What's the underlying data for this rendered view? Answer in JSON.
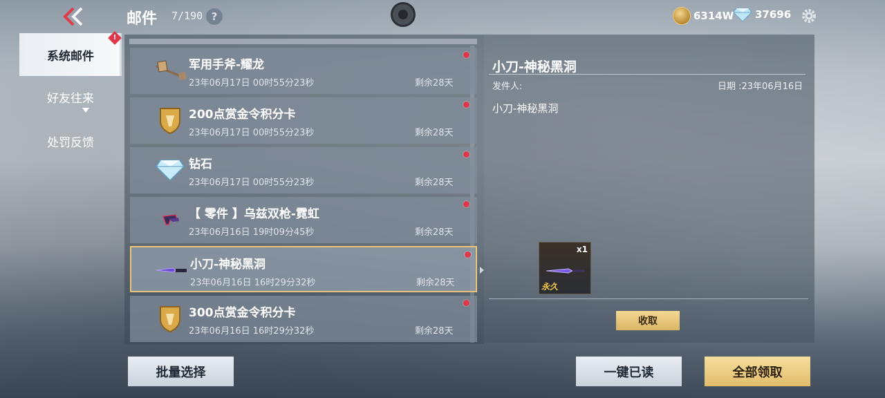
{
  "header": {
    "title": "邮件",
    "count": "7/190",
    "help_symbol": "?",
    "coins": "6314W",
    "diamonds": "37696"
  },
  "sidebar": {
    "items": [
      {
        "label": "系统邮件",
        "active": true,
        "badge": "!"
      },
      {
        "label": "好友往来",
        "active": false
      },
      {
        "label": "处罚反馈",
        "active": false
      }
    ]
  },
  "mails": [
    {
      "title": "军用手斧-耀龙",
      "date": "23年06月17日 00时55分23秒",
      "remain": "剩余28天",
      "icon": "axe-icon",
      "selected": false
    },
    {
      "title": "200点赏金令积分卡",
      "date": "23年06月17日 00时55分23秒",
      "remain": "剩余28天",
      "icon": "gold-shield-icon",
      "selected": false
    },
    {
      "title": "钻石",
      "date": "23年06月17日 00时55分23秒",
      "remain": "剩余28天",
      "icon": "diamond-icon",
      "selected": false
    },
    {
      "title": "【 零件 】乌兹双枪-霓虹",
      "date": "23年06月16日 19时09分45秒",
      "remain": "剩余28天",
      "icon": "dual-uzi-part-icon",
      "selected": false
    },
    {
      "title": "小刀-神秘黑洞",
      "date": "23年06月16日 16时29分32秒",
      "remain": "剩余28天",
      "icon": "knife-icon",
      "selected": true
    },
    {
      "title": "300点赏金令积分卡",
      "date": "23年06月16日 16时29分32秒",
      "remain": "剩余28天",
      "icon": "gold-shield-icon",
      "selected": false
    }
  ],
  "detail": {
    "title": "小刀-神秘黑洞",
    "sender_label": "发件人:",
    "date_label": "日期 :23年06月16日",
    "body": "小刀-神秘黑洞",
    "attachment": {
      "qty": "x1",
      "tag": "永久",
      "icon": "knife-icon"
    },
    "claim_label": "收取"
  },
  "actions": {
    "batch_select": "批量选择",
    "mark_all_read": "一键已读",
    "claim_all": "全部领取"
  },
  "colors": {
    "accent_gold": "#e1bd6c",
    "selected_border": "#e7c67a",
    "unread_dot": "#e0384a"
  }
}
